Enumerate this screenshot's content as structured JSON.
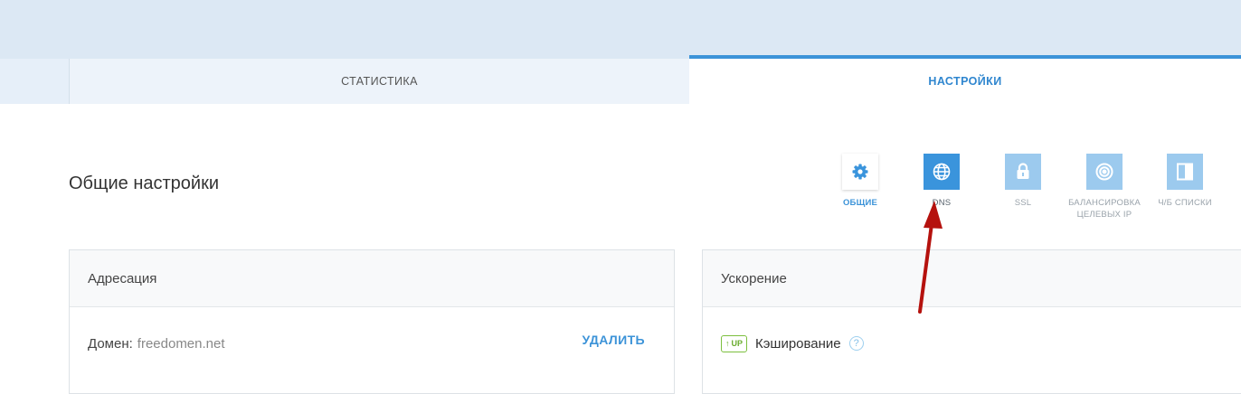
{
  "tabs": {
    "statistics": "СТАТИСТИКА",
    "settings": "НАСТРОЙКИ"
  },
  "page": {
    "title": "Общие настройки"
  },
  "icon_nav": {
    "general": {
      "label": "ОБЩИЕ",
      "icon": "gear-icon"
    },
    "dns": {
      "label": "DNS",
      "icon": "globe-icon"
    },
    "ssl": {
      "label": "SSL",
      "icon": "lock-icon"
    },
    "balancing_line1": "БАЛАНСИРОВКА",
    "balancing_line2": "ЦЕЛЕВЫХ IP",
    "balancing_icon": "target-icon",
    "lists": {
      "label": "Ч/Б СПИСКИ",
      "icon": "list-panel-icon"
    }
  },
  "addressing": {
    "title": "Адресация",
    "domain_label": "Домен:",
    "domain_value": "freedomen.net",
    "delete_label": "УДАЛИТЬ"
  },
  "acceleration": {
    "title": "Ускорение",
    "badge_text": "UP",
    "badge_arrow": "↑",
    "caching_label": "Кэширование",
    "help_glyph": "?"
  },
  "colors": {
    "accent": "#3c93d8",
    "annotation_arrow": "#b5120e",
    "badge_green": "#6aac2e"
  }
}
